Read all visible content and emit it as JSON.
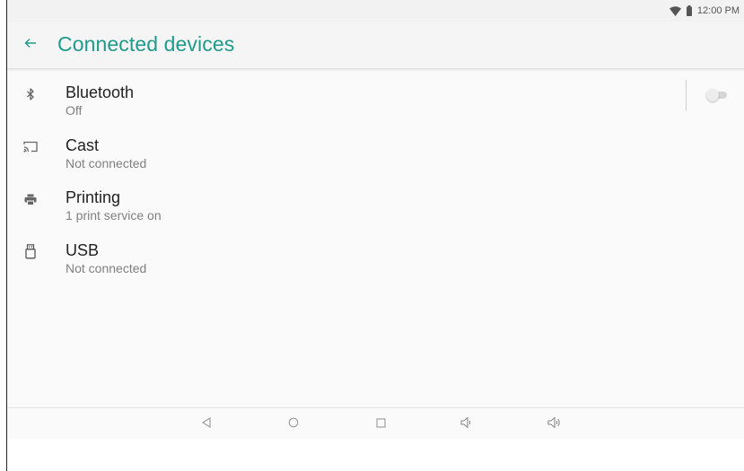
{
  "status_bar": {
    "time": "12:00 PM",
    "icons": [
      "wifi-icon",
      "battery-icon"
    ]
  },
  "app_bar": {
    "back_icon": "arrow-back-icon",
    "title": "Connected devices"
  },
  "items": [
    {
      "id": "bluetooth",
      "icon": "bluetooth-icon",
      "title": "Bluetooth",
      "summary": "Off",
      "toggle": {
        "on": false
      }
    },
    {
      "id": "cast",
      "icon": "cast-icon",
      "title": "Cast",
      "summary": "Not connected"
    },
    {
      "id": "printing",
      "icon": "print-icon",
      "title": "Printing",
      "summary": "1 print service on"
    },
    {
      "id": "usb",
      "icon": "usb-icon",
      "title": "USB",
      "summary": "Not connected"
    }
  ],
  "nav_bar": {
    "buttons": [
      "back-triangle-icon",
      "home-circle-icon",
      "recents-square-icon",
      "volume-down-icon",
      "volume-up-icon"
    ]
  },
  "colors": {
    "accent": "#1e9b8a",
    "title_text": "#222222",
    "summary_text": "#808080",
    "background": "#fafafa"
  }
}
